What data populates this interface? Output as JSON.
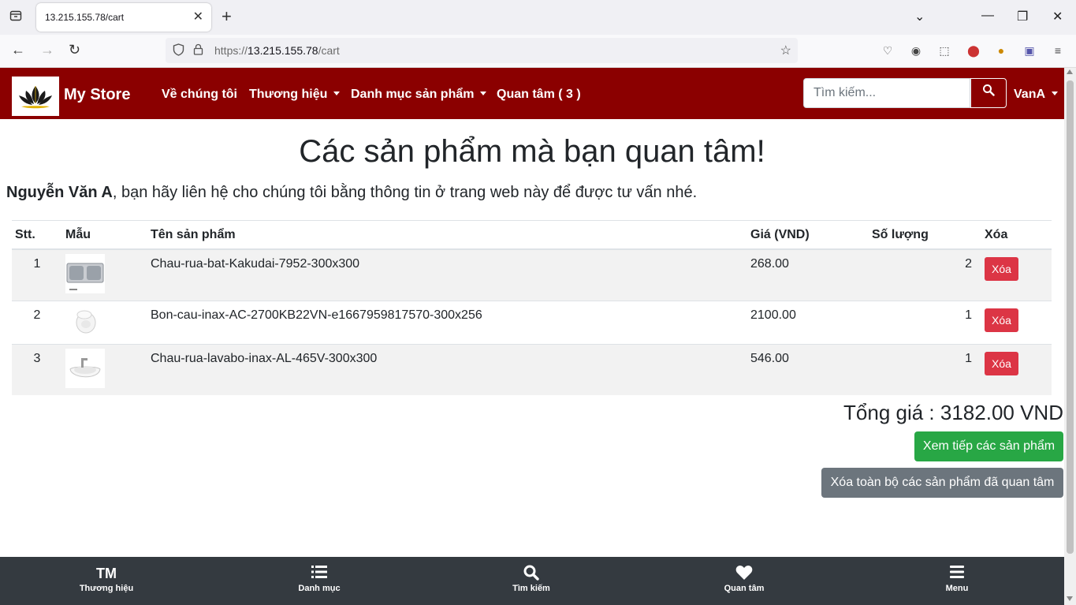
{
  "browser": {
    "tab_title": "13.215.155.78/cart",
    "url_prefix": "https://",
    "url_host": "13.215.155.78",
    "url_path": "/cart"
  },
  "nav": {
    "brand": "My Store",
    "links": [
      "Về chúng tôi",
      "Thương hiệu",
      "Danh mục sản phẩm",
      "Quan tâm ( 3 )"
    ],
    "search_placeholder": "Tìm kiếm...",
    "user": "VanA"
  },
  "page": {
    "title": "Các sản phẩm mà bạn quan tâm!",
    "intro_name": "Nguyễn Văn A",
    "intro_text": ", bạn hãy liên hệ cho chúng tôi bằng thông tin ở trang web này để được tư vấn nhé."
  },
  "table": {
    "headers": [
      "Stt.",
      "Mẫu",
      "Tên sản phẩm",
      "Giá (VND)",
      "Số lượng",
      "Xóa"
    ],
    "rows": [
      {
        "stt": "1",
        "name": "Chau-rua-bat-Kakudai-7952-300x300",
        "price": "268.00",
        "qty": "2",
        "delete": "Xóa",
        "image": "double-sink-image"
      },
      {
        "stt": "2",
        "name": "Bon-cau-inax-AC-2700KB22VN-e1667959817570-300x256",
        "price": "2100.00",
        "qty": "1",
        "delete": "Xóa",
        "image": "toilet-image"
      },
      {
        "stt": "3",
        "name": "Chau-rua-lavabo-inax-AL-465V-300x300",
        "price": "546.00",
        "qty": "1",
        "delete": "Xóa",
        "image": "washbasin-image"
      }
    ]
  },
  "summary": {
    "total": "Tổng giá : 3182.00 VND",
    "continue_label": "Xem tiếp các sản phẩm",
    "clear_label": "Xóa toàn bộ các sản phẩm đã quan tâm"
  },
  "bottom_nav": {
    "brand_icon": "TM",
    "items": [
      "Thương hiệu",
      "Danh mục",
      "Tìm kiếm",
      "Quan tâm",
      "Menu"
    ]
  },
  "colors": {
    "navbar": "#8b0000",
    "success": "#28a745",
    "danger": "#dc3545",
    "secondary": "#6c757d",
    "bottom_nav": "#343a40"
  }
}
